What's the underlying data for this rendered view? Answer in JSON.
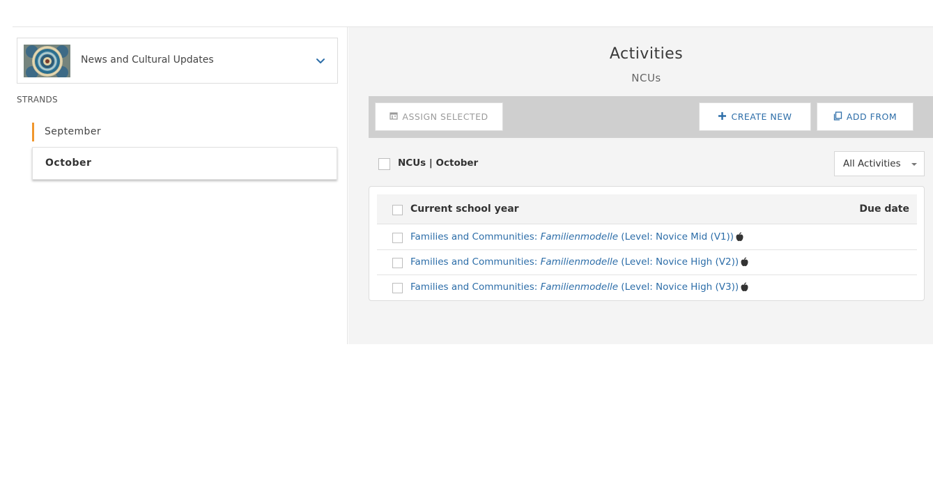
{
  "sidebar": {
    "course_name": "News and Cultural Updates",
    "course_thumb_icon": "course-mosaic-thumbnail",
    "strands_label": "STRANDS",
    "strands": [
      {
        "label": "September",
        "accent": "#f0962d"
      },
      {
        "label": "October",
        "selected": true
      }
    ]
  },
  "main": {
    "title": "Activities",
    "subtitle": "NCUs",
    "toolbar": {
      "assign_label": "ASSIGN SELECTED",
      "assign_icon": "calendar-icon",
      "create_label": "CREATE NEW",
      "create_icon": "plus-icon",
      "addfrom_label": "ADD FROM",
      "addfrom_icon": "copy-icon"
    },
    "filter": {
      "title": "NCUs | October",
      "select_value": "All Activities"
    },
    "table": {
      "col_title": "Current school year",
      "col_due": "Due date",
      "rows": [
        {
          "prefix": "Families and Communities: ",
          "italic": "Familienmodelle",
          "suffix": " (Level: Novice Mid (V1))",
          "icon": "apple-icon"
        },
        {
          "prefix": "Families and Communities: ",
          "italic": "Familienmodelle",
          "suffix": " (Level: Novice High (V2))",
          "icon": "apple-icon"
        },
        {
          "prefix": "Families and Communities: ",
          "italic": "Familienmodelle",
          "suffix": " (Level: Novice High (V3))",
          "icon": "apple-icon"
        }
      ]
    }
  },
  "colors": {
    "accent_orange": "#f0962d",
    "link_blue": "#2c6da8",
    "toolbar_gray": "#cfcfcf",
    "panel_bg": "#f4f4f4"
  }
}
